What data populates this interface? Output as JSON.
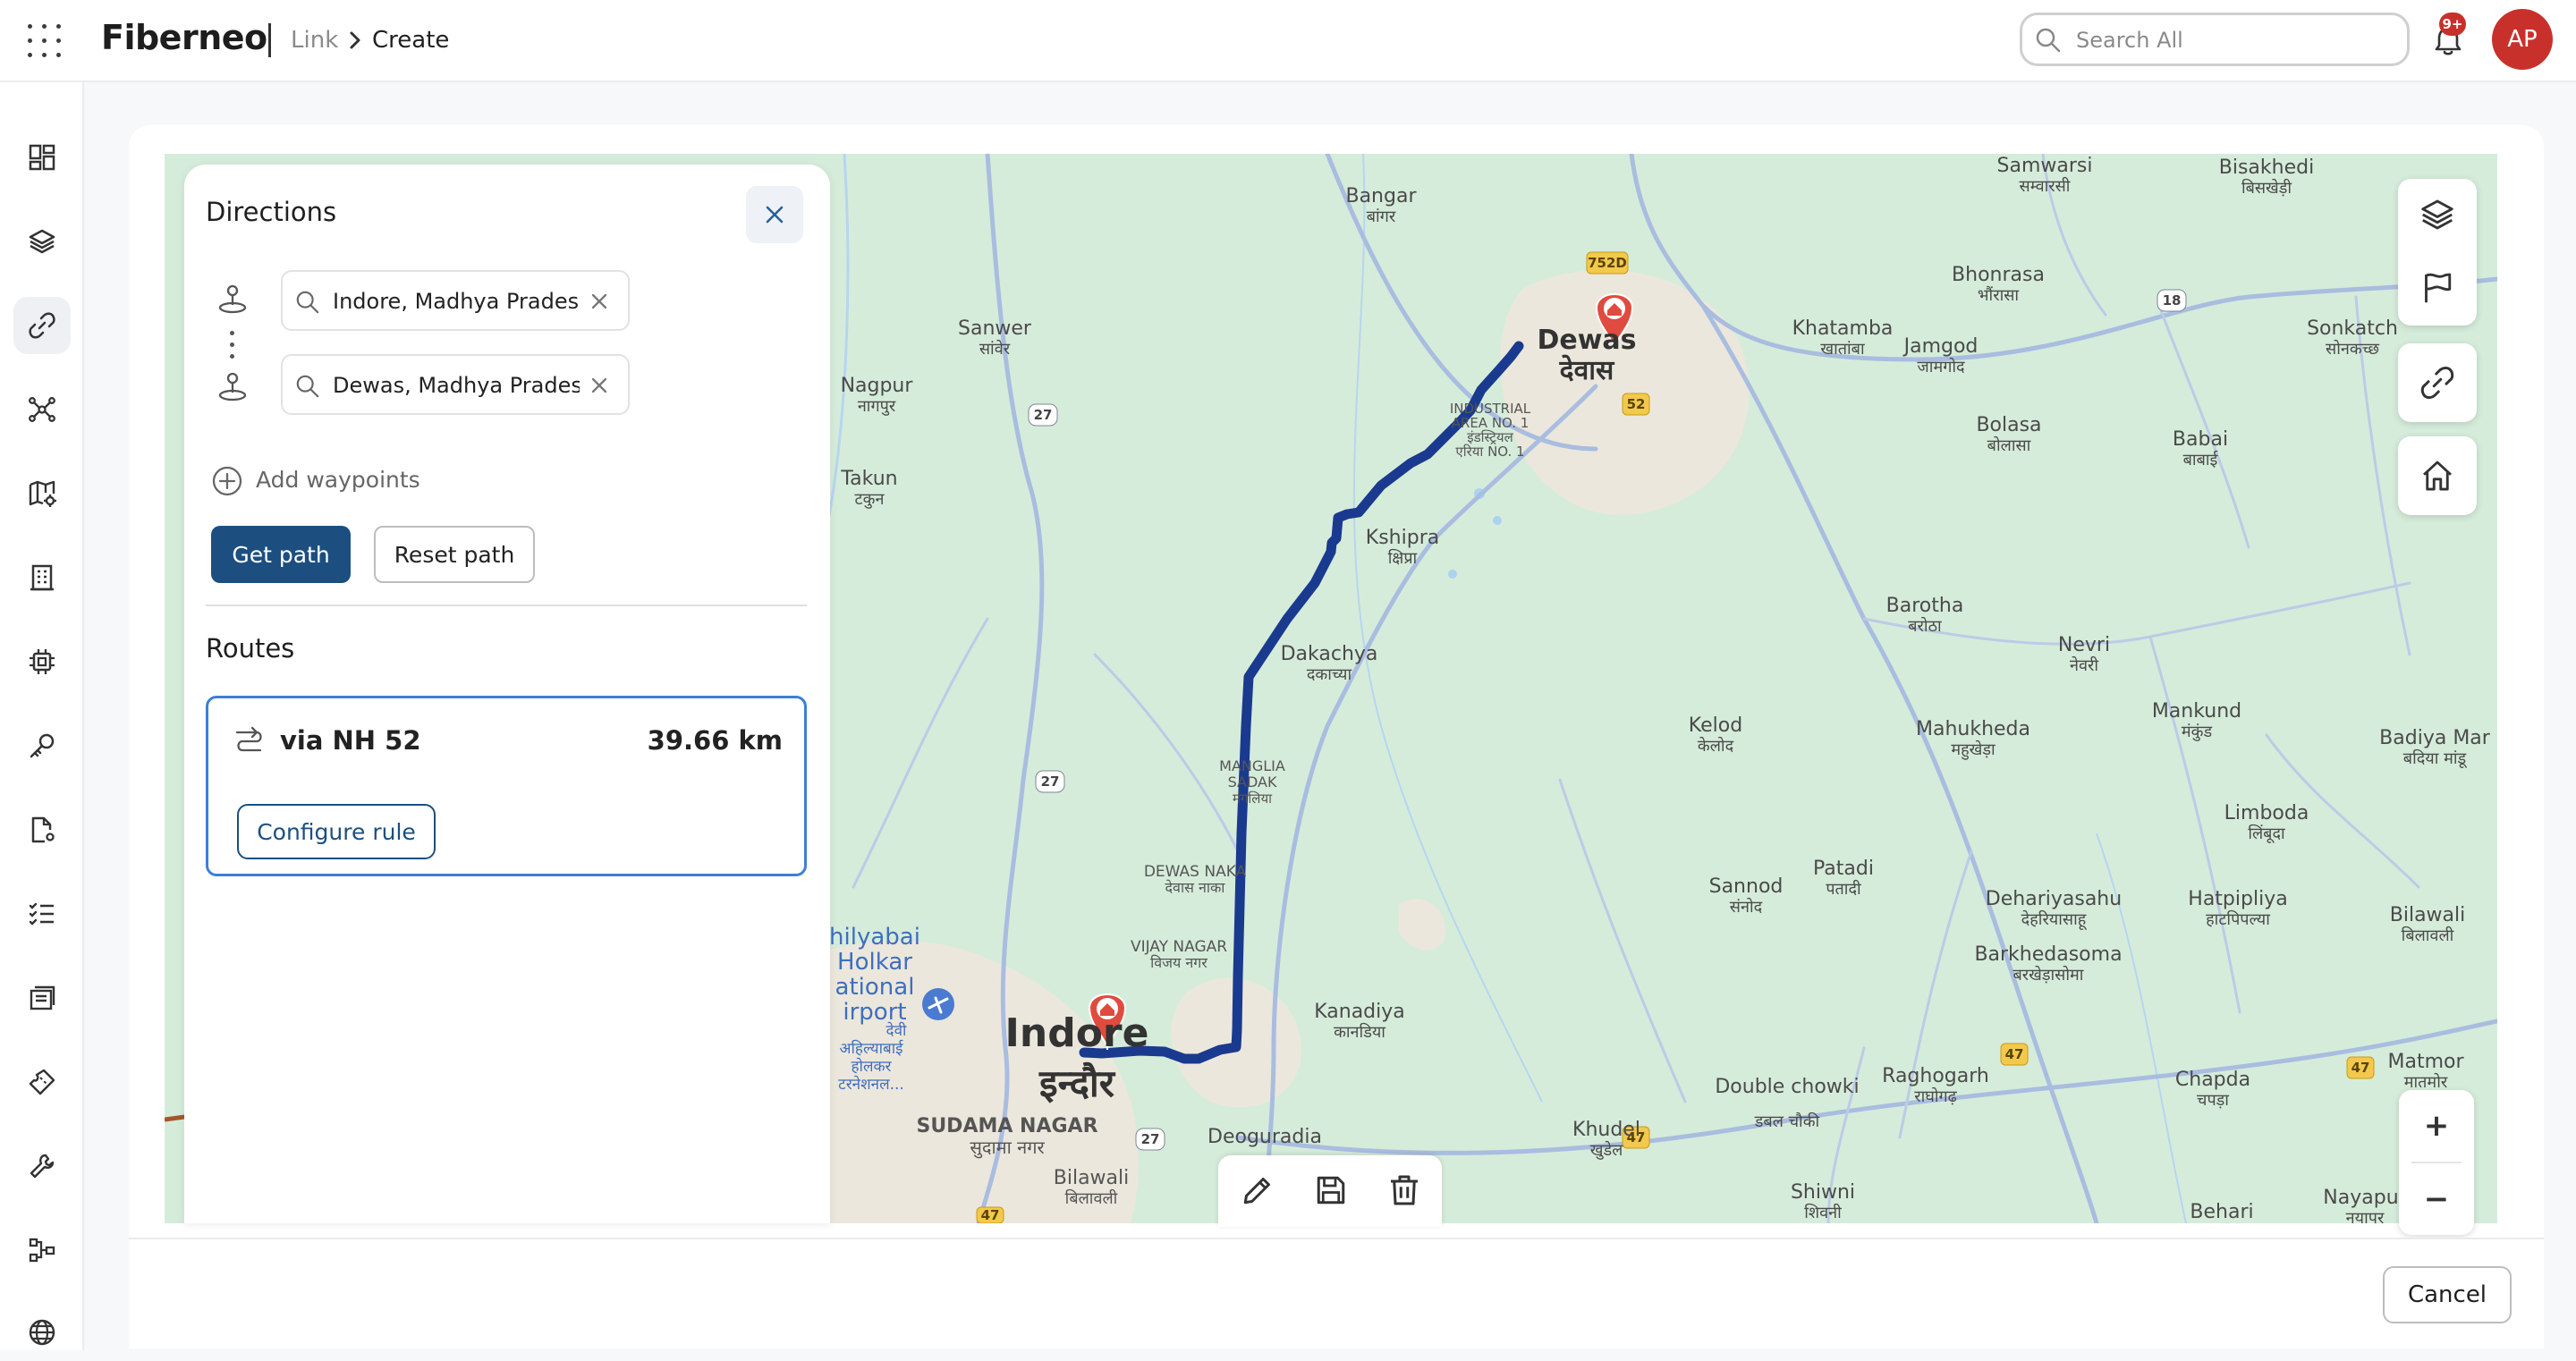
{
  "header": {
    "brand": "Fiberneo",
    "breadcrumb_link": "Link",
    "breadcrumb_current": "Create",
    "search_placeholder": "Search All",
    "notification_badge": "9+",
    "avatar_initials": "AP"
  },
  "sidebar": {
    "items": [
      {
        "icon": "dashboard-icon"
      },
      {
        "icon": "layers-icon"
      },
      {
        "icon": "link-icon",
        "active": true
      },
      {
        "icon": "network-topology-icon"
      },
      {
        "icon": "map-settings-icon"
      },
      {
        "icon": "building-icon"
      },
      {
        "icon": "chip-icon"
      },
      {
        "icon": "key-icon"
      },
      {
        "icon": "document-settings-icon"
      },
      {
        "icon": "checklist-icon"
      },
      {
        "icon": "inventory-icon"
      },
      {
        "icon": "ticket-icon"
      },
      {
        "icon": "wrench-icon"
      },
      {
        "icon": "hierarchy-icon"
      },
      {
        "icon": "globe-icon"
      }
    ]
  },
  "directions": {
    "title": "Directions",
    "origin": "Indore, Madhya Pradesh, India",
    "destination": "Dewas, Madhya Pradesh, India",
    "add_waypoints_label": "Add waypoints",
    "get_path_label": "Get path",
    "reset_path_label": "Reset path",
    "routes_title": "Routes",
    "routes": [
      {
        "name": "via NH 52",
        "distance": "39.66 km",
        "configure_label": "Configure rule"
      }
    ]
  },
  "map": {
    "colors": {
      "route": "#1a3a8f",
      "marker": "#e04b3f",
      "land": "#d6ecda",
      "urban": "#eee8dc",
      "road": "#9fb3d9"
    },
    "places": [
      {
        "name": "Bangar",
        "sub": "बांगर"
      },
      {
        "name": "Samwarsi",
        "sub": "सम्वारसी"
      },
      {
        "name": "Bisakhedi",
        "sub": "बिसखेड़ी"
      },
      {
        "name": "Bhonrasa",
        "sub": "भौंरासा"
      },
      {
        "name": "Sanwer",
        "sub": "सांवेर"
      },
      {
        "name": "Khatamba",
        "sub": "खातांबा"
      },
      {
        "name": "Jamgod",
        "sub": "जामगोद"
      },
      {
        "name": "Sonkatch",
        "sub": "सोनकच्छ"
      },
      {
        "name": "Nagpur",
        "sub": "नागपुर"
      },
      {
        "name": "Bolasa",
        "sub": "बोलासा"
      },
      {
        "name": "Babai",
        "sub": "बाबाई"
      },
      {
        "name": "Takun",
        "sub": "टकुन"
      },
      {
        "name": "Kshipra",
        "sub": "क्षिप्रा"
      },
      {
        "name": "Barotha",
        "sub": "बरोठा"
      },
      {
        "name": "Nevri",
        "sub": "नेवरी"
      },
      {
        "name": "Dakachya",
        "sub": "दकाच्या"
      },
      {
        "name": "Kelod",
        "sub": "केलोद"
      },
      {
        "name": "Mahukheda",
        "sub": "महुखेड़ा"
      },
      {
        "name": "Mankund",
        "sub": "मंकुंड"
      },
      {
        "name": "Badiya Mar",
        "sub": "बदिया मांडू"
      },
      {
        "name": "Limboda",
        "sub": "लिंबूदा"
      },
      {
        "name": "Sannod",
        "sub": "संनोद"
      },
      {
        "name": "Patadi",
        "sub": "पतादी"
      },
      {
        "name": "Dehariyasahu",
        "sub": "देहरियासाहू"
      },
      {
        "name": "Hatpipliya",
        "sub": "हाटपिपल्या"
      },
      {
        "name": "Bilawali",
        "sub": "बिलावली"
      },
      {
        "name": "Barkhedasoma",
        "sub": "बरखेड़ासोमा"
      },
      {
        "name": "Kanadiya",
        "sub": "कानडिया"
      },
      {
        "name": "Double chowki",
        "sub": "डबल चौकी"
      },
      {
        "name": "Raghogarh",
        "sub": "राघोगढ़"
      },
      {
        "name": "Chapda",
        "sub": "चपड़ा"
      },
      {
        "name": "Matmor",
        "sub": "मातमोर"
      },
      {
        "name": "Khudel",
        "sub": "खुडेल"
      },
      {
        "name": "Deoguradia",
        "sub": ""
      },
      {
        "name": "Shiwni",
        "sub": "शिवनी"
      },
      {
        "name": "Behari",
        "sub": ""
      },
      {
        "name": "Nayapur",
        "sub": "नयापुर"
      }
    ],
    "city_labels": {
      "indore": "Indore",
      "indore_hi": "इन्दौर",
      "dewas": "Dewas",
      "dewas_hi": "देवास",
      "sudama_nagar": "SUDAMA NAGAR",
      "sudama_nagar_hi": "सुदामा नगर",
      "bilawali_s": "Bilawali",
      "bilawali_s_hi": "बिलावली",
      "dewas_naka": "DEWAS NAKA",
      "dewas_naka_hi": "देवास नाका",
      "vijay_nagar": "VIJAY NAGAR",
      "vijay_nagar_hi": "विजय नगर",
      "manglia": "MANGLIA",
      "manglia2": "SADAK",
      "manglia_hi": "मंगलिया",
      "industrial": "INDUSTRIAL",
      "industrial2": "AREA NO. 1",
      "industrial_hi": "इंडस्ट्रियल",
      "industrial_hi2": "एरिया NO. 1",
      "airport": "hilyabai",
      "airport2": "Holkar",
      "airport3": "ational",
      "airport4": "irport",
      "airport_hi": "देवी",
      "airport_hi2": "अहिल्याबाई",
      "airport_hi3": "होलकर",
      "airport_hi4": "टरनेशनल..."
    },
    "highway_shields": [
      "752D",
      "52",
      "27",
      "18",
      "27",
      "27",
      "47",
      "47",
      "47",
      "47"
    ],
    "zoom_in_label": "+",
    "zoom_out_label": "−"
  },
  "footer": {
    "cancel_label": "Cancel"
  }
}
